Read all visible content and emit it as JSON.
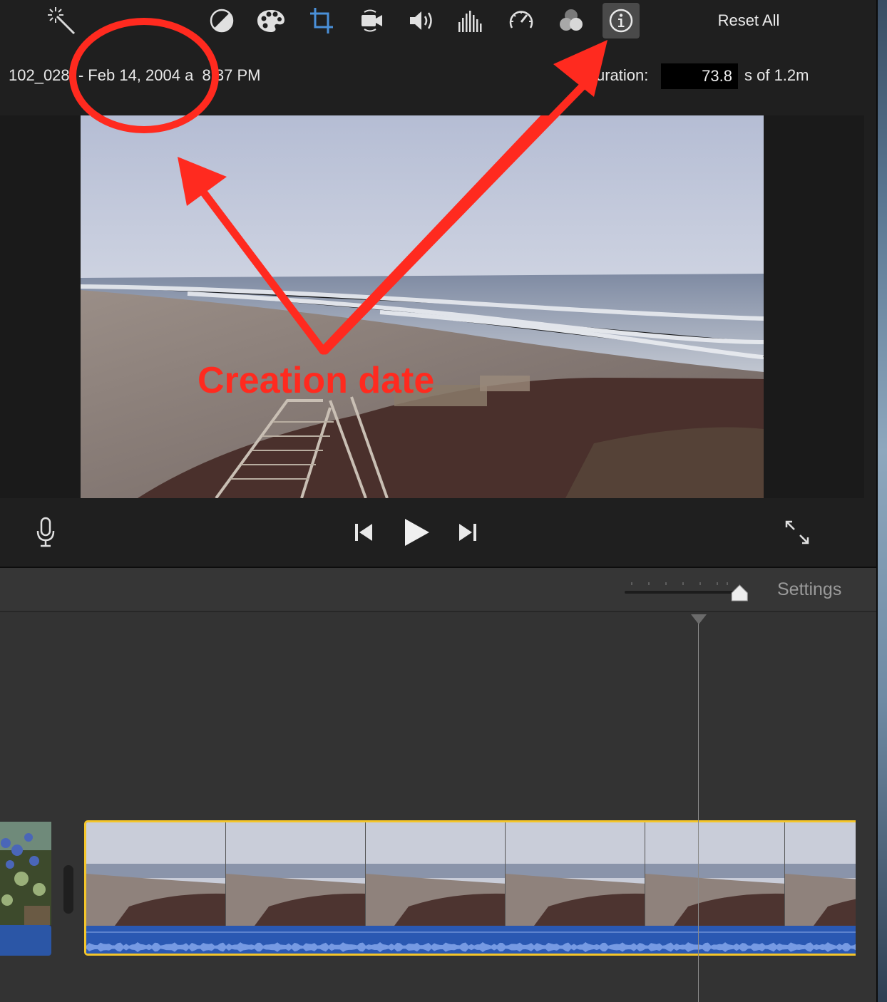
{
  "toolbar": {
    "tools": [
      {
        "name": "enhance-wand-icon"
      },
      {
        "name": "color-balance-icon"
      },
      {
        "name": "color-correction-palette-icon"
      },
      {
        "name": "crop-icon",
        "accent": "#4a90d9"
      },
      {
        "name": "stabilization-camera-icon"
      },
      {
        "name": "volume-icon"
      },
      {
        "name": "noise-equalizer-icon"
      },
      {
        "name": "speed-gauge-icon"
      },
      {
        "name": "video-overlay-icon"
      },
      {
        "name": "clip-info-icon",
        "active": true
      }
    ],
    "reset_all": "Reset All"
  },
  "clip_info": {
    "title": "102_028  - Feb 14, 2004 a  8:37 PM",
    "duration_label": "uration:",
    "duration_value": "73.8",
    "duration_suffix": "s of 1.2m"
  },
  "annotation": {
    "caption": "Creation date",
    "color": "#ff2a1f"
  },
  "playback": {
    "microphone": "microphone-icon",
    "previous": "skip-back-icon",
    "play": "play-icon",
    "next": "skip-forward-icon",
    "fullscreen": "fullscreen-icon"
  },
  "timeline": {
    "settings_label": "Settings",
    "zoom_level": 0.96,
    "clip_border_color": "#f4c52a",
    "audio_color": "#2a58b2"
  }
}
